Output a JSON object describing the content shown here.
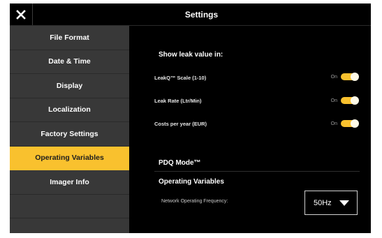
{
  "header": {
    "title": "Settings",
    "close_icon": "close-icon"
  },
  "sidebar": {
    "items": [
      {
        "label": "File Format"
      },
      {
        "label": "Date & Time"
      },
      {
        "label": "Display"
      },
      {
        "label": "Localization"
      },
      {
        "label": "Factory Settings"
      },
      {
        "label": "Operating Variables",
        "active": true
      },
      {
        "label": "Imager Info"
      },
      {
        "label": ""
      }
    ]
  },
  "content": {
    "leak_section_title": "Show leak value in:",
    "toggles": [
      {
        "label": "LeakQ™ Scale (1-10)",
        "state": "On"
      },
      {
        "label": "Leak Rate (Ltr/Min)",
        "state": "On"
      },
      {
        "label": "Costs per year (EUR)",
        "state": "On"
      }
    ],
    "pdq_mode": "PDQ Mode™",
    "operating_variables_title": "Operating Variables",
    "network_frequency_label": "Network Operating Frequency:",
    "network_frequency_value": "50Hz"
  },
  "colors": {
    "accent": "#f9c12e",
    "background": "#000000",
    "sidebar": "#383838"
  }
}
